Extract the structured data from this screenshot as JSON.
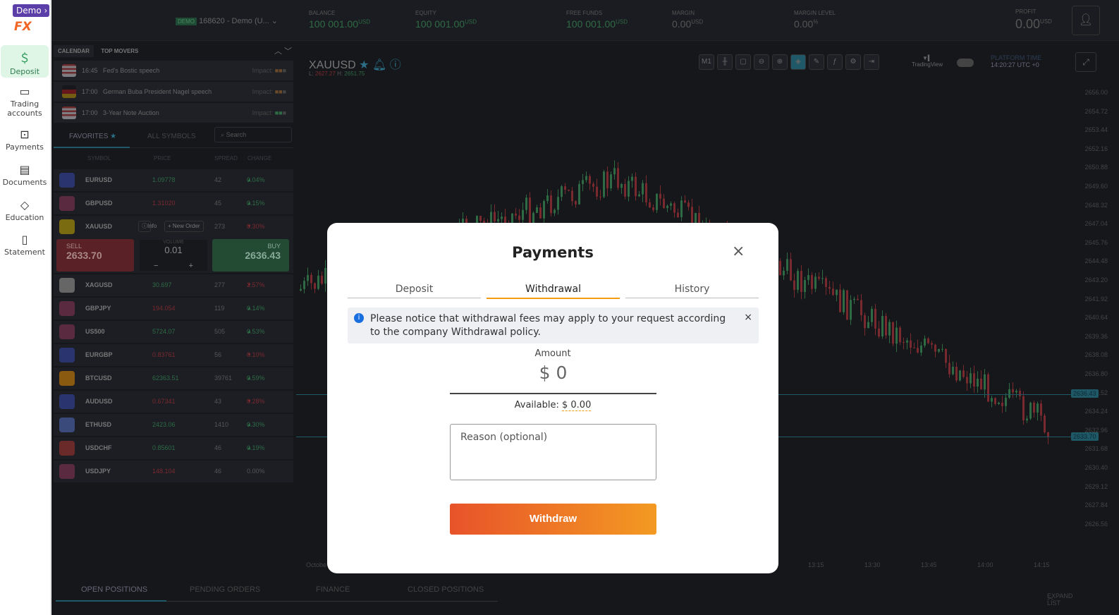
{
  "sidebar": {
    "demo_badge": "Demo",
    "logo": "FX",
    "items": [
      {
        "label": "Deposit",
        "icon": "dollar-icon"
      },
      {
        "label": "Trading accounts",
        "icon": "wallet-icon"
      },
      {
        "label": "Payments",
        "icon": "cash-icon"
      },
      {
        "label": "Documents",
        "icon": "id-card-icon"
      },
      {
        "label": "Education",
        "icon": "graduation-cap-icon"
      },
      {
        "label": "Statement",
        "icon": "report-icon"
      }
    ]
  },
  "header": {
    "account_badge": "DEMO",
    "account": "168620 - Demo (U...",
    "stats": [
      {
        "label": "BALANCE",
        "value": "100 001.00",
        "unit": "USD"
      },
      {
        "label": "EQUITY",
        "value": "100 001.00",
        "unit": "USD"
      },
      {
        "label": "FREE FUNDS",
        "value": "100 001.00",
        "unit": "USD"
      },
      {
        "label": "MARGIN",
        "value": "0.00",
        "unit": "USD"
      },
      {
        "label": "MARGIN LEVEL",
        "value": "0.00",
        "unit": "%"
      }
    ],
    "profit": {
      "label": "PROFIT",
      "value": "0.00",
      "unit": "USD"
    }
  },
  "calendar": {
    "tabs": [
      "CALENDAR",
      "TOP MOVERS"
    ],
    "impact_label": "Impact:",
    "events": [
      {
        "time": "16:45",
        "title": "Fed's Bostic speech"
      },
      {
        "time": "17:00",
        "title": "German Buba President Nagel speech"
      },
      {
        "time": "17:00",
        "title": "3-Year Note Auction"
      }
    ]
  },
  "symbols": {
    "tabs": [
      "FAVORITES",
      "ALL SYMBOLS"
    ],
    "search_placeholder": "Search",
    "columns": [
      "SYMBOL",
      "PRICE",
      "SPREAD",
      "CHANGE"
    ],
    "rows": [
      {
        "symbol": "EURUSD",
        "price": "1.09778",
        "spread": "42",
        "change": "0.04%",
        "dir": "up"
      },
      {
        "symbol": "GBPUSD",
        "price": "1.31020",
        "spread": "45",
        "change": "0.15%",
        "dir": "up"
      },
      {
        "symbol": "XAUUSD",
        "price": "",
        "spread": "273",
        "change": "0.30%",
        "dir": "down"
      },
      {
        "symbol": "XAGUSD",
        "price": "30.697",
        "spread": "277",
        "change": "2.57%",
        "dir": "down"
      },
      {
        "symbol": "GBPJPY",
        "price": "194.054",
        "spread": "119",
        "change": "0.14%",
        "dir": "up"
      },
      {
        "symbol": "US500",
        "price": "5724.07",
        "spread": "505",
        "change": "0.53%",
        "dir": "up"
      },
      {
        "symbol": "EURGBP",
        "price": "0.83761",
        "spread": "56",
        "change": "0.10%",
        "dir": "down"
      },
      {
        "symbol": "BTCUSD",
        "price": "62363.51",
        "spread": "39761",
        "change": "0.59%",
        "dir": "up"
      },
      {
        "symbol": "AUDUSD",
        "price": "0.67341",
        "spread": "43",
        "change": "0.28%",
        "dir": "down"
      },
      {
        "symbol": "ETHUSD",
        "price": "2423.06",
        "spread": "1410",
        "change": "0.30%",
        "dir": "up"
      },
      {
        "symbol": "USDCHF",
        "price": "0.85601",
        "spread": "46",
        "change": "0.19%",
        "dir": "up"
      },
      {
        "symbol": "USDJPY",
        "price": "148.104",
        "spread": "46",
        "change": "0.00%",
        "dir": "flat"
      }
    ],
    "info": "Info",
    "new_order": "+ New Order",
    "trade": {
      "sell_label": "SELL",
      "sell": "2633.70",
      "buy_label": "BUY",
      "buy": "2636.43",
      "volume_label": "VOLUME",
      "volume": "0.01",
      "minus": "−",
      "plus": "+"
    }
  },
  "chart": {
    "symbol": "XAUUSD",
    "low_label": "L:",
    "low": "2627.27",
    "high_label": "H:",
    "high": "2651.75",
    "timeframe": "M1",
    "tv_label": "TradingView",
    "platform_time_label": "PLATFORM TIME",
    "platform_time": "14:20:27 UTC +0",
    "y_ticks": [
      "2656.00",
      "2654.72",
      "2653.44",
      "2652.16",
      "2650.88",
      "2649.60",
      "2648.32",
      "2647.04",
      "2645.76",
      "2644.48",
      "2643.20",
      "2641.92",
      "2640.64",
      "2639.36",
      "2638.08",
      "2636.80",
      "2635.52",
      "2634.24",
      "2632.96",
      "2631.68",
      "2630.40",
      "2629.12",
      "2627.84",
      "2626.56"
    ],
    "x_ticks": [
      "Octobe",
      "13:15",
      "13:30",
      "13:45",
      "14:00",
      "14:15"
    ],
    "ask_tag": "2636.43",
    "bid_tag": "2633.70"
  },
  "bottom": {
    "tabs": [
      "OPEN POSITIONS",
      "PENDING ORDERS",
      "FINANCE",
      "CLOSED POSITIONS"
    ],
    "expand": "EXPAND LIST"
  },
  "modal": {
    "title": "Payments",
    "tabs": [
      "Deposit",
      "Withdrawal",
      "History"
    ],
    "notice": "Please notice that withdrawal fees may apply to your request according to the company Withdrawal policy.",
    "amount_label": "Amount",
    "amount": "$ 0",
    "available_label": "Available:",
    "available": "$ 0.00",
    "reason_placeholder": "Reason (optional)",
    "submit": "Withdraw"
  },
  "colors": {
    "up": "#2e6b45",
    "down": "#7a2a2e",
    "accent": "#f39c12",
    "modal_button_from": "#e8532a",
    "modal_button_to": "#f39a22"
  }
}
